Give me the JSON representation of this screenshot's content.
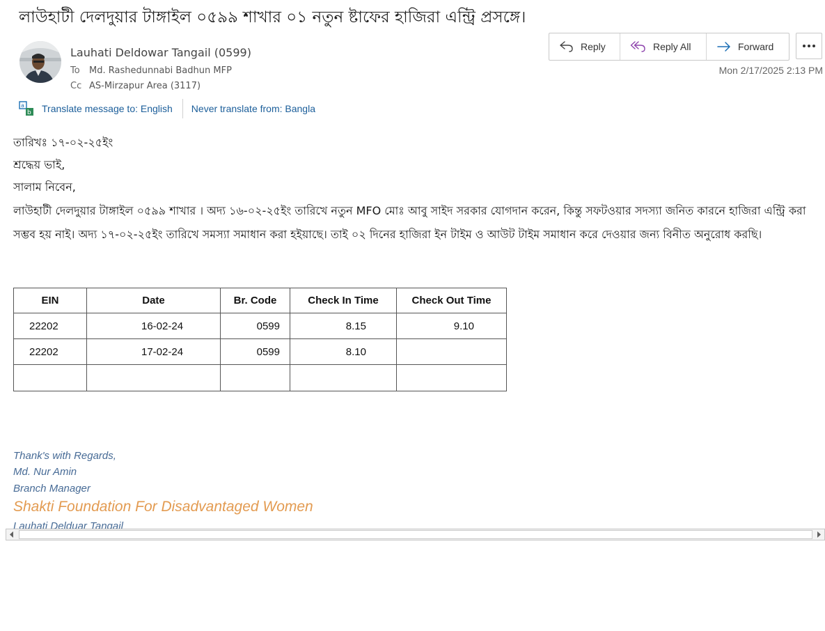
{
  "email": {
    "subject": "লাউহাটী দেলদুয়ার টাঙ্গাইল ০৫৯৯ শাখার ০১ নতুন  ষ্টাফের হাজিরা এন্ট্রি প্রসঙ্গে।",
    "sender": "Lauhati  Deldowar Tangail (0599)",
    "to_label": "To",
    "to": "Md. Rashedunnabi Badhun MFP",
    "cc_label": "Cc",
    "cc": "AS-Mirzapur Area (3117)",
    "datetime": "Mon 2/17/2025 2:13 PM"
  },
  "actions": {
    "reply": "Reply",
    "reply_all": "Reply All",
    "forward": "Forward"
  },
  "translate": {
    "translate_to": "Translate message to: English",
    "never_translate": "Never translate from: Bangla"
  },
  "body": {
    "date_line": "তারিখঃ ১৭-০২-২৫ইং",
    "greeting": "শ্রদ্ধেয় ভাই,",
    "salutation": "সালাম নিবেন,",
    "paragraph": "লাউহাটী দেলদুয়ার টাঙ্গাইল ০৫৯৯ শাখার  । অদ্য ১৬-০২-২৫ইং তারিখে নতুন MFO মোঃ আবু সাইদ সরকার যোগদান করেন, কিন্তু সফটওয়ার সদস্যা জনিত কারনে হাজিরা এন্ট্রি করা সম্ভব হয় নাই। অদ্য ১৭-০২-২৫ইং তারিখে সমস্যা সমাধান করা  হইয়াছে। তাই ০২ দিনের হাজিরা  ইন টাইম ও আউট টাইম সমাধান করে দেওয়ার জন্য বিনীত অনুরোধ করছি।"
  },
  "table": {
    "headers": [
      "EIN",
      "Date",
      "Br. Code",
      "Check In Time",
      "Check Out Time"
    ],
    "rows": [
      [
        "22202",
        "16-02-24",
        "0599",
        "8.15",
        "9.10"
      ],
      [
        "22202",
        "17-02-24",
        "0599",
        "8.10",
        ""
      ],
      [
        "",
        "",
        "",
        "",
        ""
      ]
    ]
  },
  "signature": {
    "thanks": "Thank's with Regards,",
    "name": "Md. Nur Amin",
    "title": "Branch Manager",
    "org": "Shakti Foundation For Disadvantaged Women",
    "branch": "Lauhati Delduar Tangail"
  },
  "colors": {
    "link": "#1b5e9a",
    "signature": "#476b96",
    "org": "#e39b51",
    "reply_all_icon": "#8e44ad",
    "forward_icon": "#1b6fb5"
  },
  "icons": {
    "reply": "reply-icon",
    "reply_all": "reply-all-icon",
    "forward": "forward-icon",
    "more": "more-icon",
    "translate": "translate-icon"
  }
}
